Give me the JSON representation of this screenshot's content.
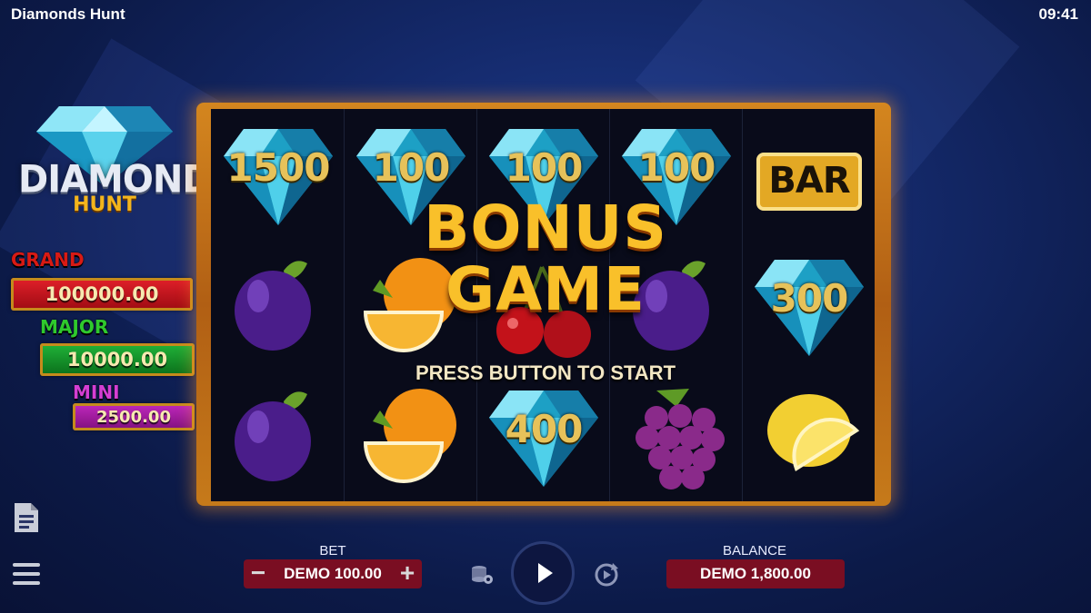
{
  "app": {
    "title": "Diamonds Hunt",
    "time": "09:41"
  },
  "logo": {
    "line1": "DIAMONDS",
    "line2": "HUNT"
  },
  "jackpots": [
    {
      "label": "GRAND",
      "value": "100000.00",
      "color": "#c51218",
      "label_color": "#d81a14"
    },
    {
      "label": "MAJOR",
      "value": "10000.00",
      "color": "#0e8f24",
      "label_color": "#2fc92d"
    },
    {
      "label": "MINI",
      "value": "2500.00",
      "color": "#9c1a9a",
      "label_color": "#d43ed3"
    }
  ],
  "reels": [
    [
      {
        "type": "diamond",
        "value": "1500"
      },
      {
        "type": "plum"
      },
      {
        "type": "plum"
      }
    ],
    [
      {
        "type": "diamond",
        "value": "100"
      },
      {
        "type": "orange"
      },
      {
        "type": "orange"
      }
    ],
    [
      {
        "type": "diamond",
        "value": "100"
      },
      {
        "type": "cherry"
      },
      {
        "type": "diamond",
        "value": "400"
      }
    ],
    [
      {
        "type": "diamond",
        "value": "100"
      },
      {
        "type": "plum"
      },
      {
        "type": "grapes"
      }
    ],
    [
      {
        "type": "bar",
        "value": "BAR"
      },
      {
        "type": "diamond",
        "value": "300"
      },
      {
        "type": "lemon"
      }
    ]
  ],
  "overlay": {
    "line1": "BONUS",
    "line2": "GAME",
    "prompt": "PRESS BUTTON TO START"
  },
  "bet": {
    "label": "BET",
    "value": "DEMO 100.00",
    "minus": "−",
    "plus": "+"
  },
  "balance": {
    "label": "BALANCE",
    "value": "DEMO 1,800.00"
  },
  "icons": [
    "paytable-icon",
    "menu-icon",
    "coins-settings-icon",
    "play-icon",
    "autoplay-icon"
  ]
}
